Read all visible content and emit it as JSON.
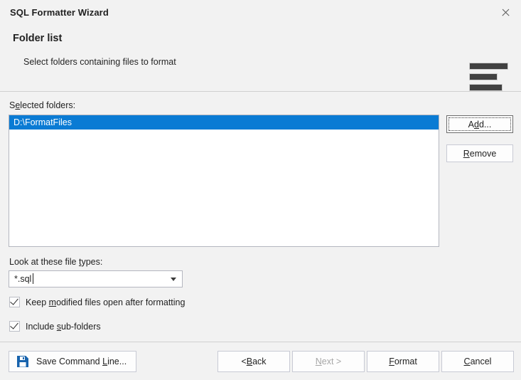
{
  "window": {
    "title": "SQL Formatter Wizard",
    "close_icon": "close-icon"
  },
  "header": {
    "title": "Folder list",
    "subtitle": "Select folders containing files to format",
    "icon": "format-lines-icon"
  },
  "body": {
    "selected_folders_label": {
      "before": "S",
      "accel": "e",
      "after": "lected folders:"
    },
    "folders": [
      {
        "path": "D:\\FormatFiles",
        "selected": true
      }
    ],
    "add_button": {
      "before": "A",
      "accel": "d",
      "after": "d..."
    },
    "remove_button": {
      "before": "",
      "accel": "R",
      "after": "emove"
    },
    "file_types_label": {
      "before": "Look at these file ",
      "accel": "t",
      "after": "ypes:"
    },
    "file_types_value": "*.sql",
    "file_types_options": [
      "*.sql"
    ],
    "checkboxes": [
      {
        "checked": true,
        "before": "Keep ",
        "accel": "m",
        "after": "odified files open after formatting"
      },
      {
        "checked": true,
        "before": "Include ",
        "accel": "s",
        "after": "ub-folders"
      }
    ]
  },
  "footer": {
    "save_command_line": {
      "before": "Save Command ",
      "accel": "L",
      "after": "ine..."
    },
    "back": {
      "before": "< ",
      "accel": "B",
      "after": "ack"
    },
    "next": {
      "before": "",
      "accel": "N",
      "after": "ext >",
      "disabled": true
    },
    "format": {
      "before": "",
      "accel": "F",
      "after": "ormat"
    },
    "cancel": {
      "before": "",
      "accel": "C",
      "after": "ancel"
    },
    "save_icon": "floppy-disk-save-icon"
  },
  "colors": {
    "accent_blue": "#0a7bd4",
    "dialog_background": "#f2f2f2",
    "field_background": "#ffffff",
    "field_border": "#b4b6bf",
    "text": "#1f1f1f",
    "disabled_text": "#a6a6a6",
    "icon_dark": "#414141",
    "save_icon_blue": "#1763ad"
  }
}
